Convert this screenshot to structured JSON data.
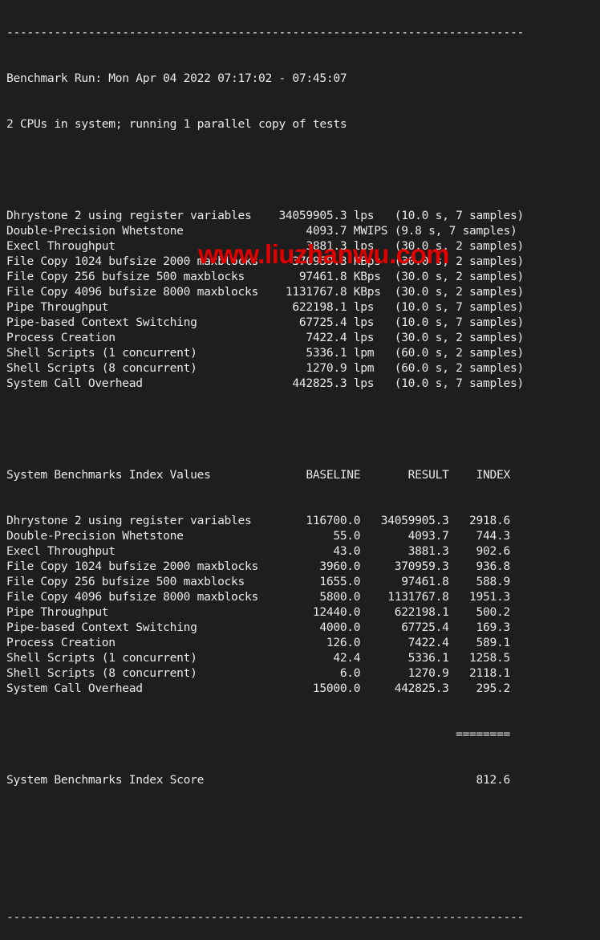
{
  "separator": "----------------------------------------------------------------------------",
  "run_header": "Benchmark Run: Mon Apr 04 2022 07:17:02 - 07:45:07",
  "cpu_info": "2 CPUs in system; running 1 parallel copy of tests",
  "raw_results": [
    {
      "name": "Dhrystone 2 using register variables",
      "value": "34059905.3",
      "unit": "lps",
      "detail": "(10.0 s, 7 samples)"
    },
    {
      "name": "Double-Precision Whetstone",
      "value": "4093.7",
      "unit": "MWIPS",
      "detail": "(9.8 s, 7 samples)"
    },
    {
      "name": "Execl Throughput",
      "value": "3881.3",
      "unit": "lps",
      "detail": "(30.0 s, 2 samples)"
    },
    {
      "name": "File Copy 1024 bufsize 2000 maxblocks",
      "value": "370959.3",
      "unit": "KBps",
      "detail": "(30.0 s, 2 samples)"
    },
    {
      "name": "File Copy 256 bufsize 500 maxblocks",
      "value": "97461.8",
      "unit": "KBps",
      "detail": "(30.0 s, 2 samples)"
    },
    {
      "name": "File Copy 4096 bufsize 8000 maxblocks",
      "value": "1131767.8",
      "unit": "KBps",
      "detail": "(30.0 s, 2 samples)"
    },
    {
      "name": "Pipe Throughput",
      "value": "622198.1",
      "unit": "lps",
      "detail": "(10.0 s, 7 samples)"
    },
    {
      "name": "Pipe-based Context Switching",
      "value": "67725.4",
      "unit": "lps",
      "detail": "(10.0 s, 7 samples)"
    },
    {
      "name": "Process Creation",
      "value": "7422.4",
      "unit": "lps",
      "detail": "(30.0 s, 2 samples)"
    },
    {
      "name": "Shell Scripts (1 concurrent)",
      "value": "5336.1",
      "unit": "lpm",
      "detail": "(60.0 s, 2 samples)"
    },
    {
      "name": "Shell Scripts (8 concurrent)",
      "value": "1270.9",
      "unit": "lpm",
      "detail": "(60.0 s, 2 samples)"
    },
    {
      "name": "System Call Overhead",
      "value": "442825.3",
      "unit": "lps",
      "detail": "(10.0 s, 7 samples)"
    }
  ],
  "index_header": {
    "title": "System Benchmarks Index Values",
    "baseline": "BASELINE",
    "result": "RESULT",
    "index": "INDEX"
  },
  "index_results": [
    {
      "name": "Dhrystone 2 using register variables",
      "baseline": "116700.0",
      "result": "34059905.3",
      "index": "2918.6"
    },
    {
      "name": "Double-Precision Whetstone",
      "baseline": "55.0",
      "result": "4093.7",
      "index": "744.3"
    },
    {
      "name": "Execl Throughput",
      "baseline": "43.0",
      "result": "3881.3",
      "index": "902.6"
    },
    {
      "name": "File Copy 1024 bufsize 2000 maxblocks",
      "baseline": "3960.0",
      "result": "370959.3",
      "index": "936.8"
    },
    {
      "name": "File Copy 256 bufsize 500 maxblocks",
      "baseline": "1655.0",
      "result": "97461.8",
      "index": "588.9"
    },
    {
      "name": "File Copy 4096 bufsize 8000 maxblocks",
      "baseline": "5800.0",
      "result": "1131767.8",
      "index": "1951.3"
    },
    {
      "name": "Pipe Throughput",
      "baseline": "12440.0",
      "result": "622198.1",
      "index": "500.2"
    },
    {
      "name": "Pipe-based Context Switching",
      "baseline": "4000.0",
      "result": "67725.4",
      "index": "169.3"
    },
    {
      "name": "Process Creation",
      "baseline": "126.0",
      "result": "7422.4",
      "index": "589.1"
    },
    {
      "name": "Shell Scripts (1 concurrent)",
      "baseline": "42.4",
      "result": "5336.1",
      "index": "1258.5"
    },
    {
      "name": "Shell Scripts (8 concurrent)",
      "baseline": "6.0",
      "result": "1270.9",
      "index": "2118.1"
    },
    {
      "name": "System Call Overhead",
      "baseline": "15000.0",
      "result": "442825.3",
      "index": "295.2"
    }
  ],
  "score_rule": "========",
  "score_label": "System Benchmarks Index Score",
  "score_value": "812.6",
  "watermark": "www.liuzhanwu.com",
  "colors": {
    "background": "#1e1e1e",
    "text": "#e8e8e8",
    "watermark": "#e00000"
  }
}
